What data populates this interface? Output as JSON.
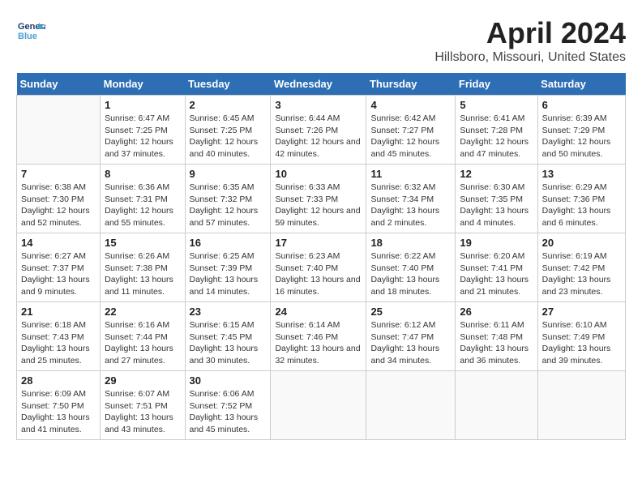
{
  "header": {
    "logo_line1": "General",
    "logo_line2": "Blue",
    "title": "April 2024",
    "subtitle": "Hillsboro, Missouri, United States"
  },
  "weekdays": [
    "Sunday",
    "Monday",
    "Tuesday",
    "Wednesday",
    "Thursday",
    "Friday",
    "Saturday"
  ],
  "weeks": [
    [
      {
        "day": "",
        "sunrise": "",
        "sunset": "",
        "daylight": ""
      },
      {
        "day": "1",
        "sunrise": "Sunrise: 6:47 AM",
        "sunset": "Sunset: 7:25 PM",
        "daylight": "Daylight: 12 hours and 37 minutes."
      },
      {
        "day": "2",
        "sunrise": "Sunrise: 6:45 AM",
        "sunset": "Sunset: 7:25 PM",
        "daylight": "Daylight: 12 hours and 40 minutes."
      },
      {
        "day": "3",
        "sunrise": "Sunrise: 6:44 AM",
        "sunset": "Sunset: 7:26 PM",
        "daylight": "Daylight: 12 hours and 42 minutes."
      },
      {
        "day": "4",
        "sunrise": "Sunrise: 6:42 AM",
        "sunset": "Sunset: 7:27 PM",
        "daylight": "Daylight: 12 hours and 45 minutes."
      },
      {
        "day": "5",
        "sunrise": "Sunrise: 6:41 AM",
        "sunset": "Sunset: 7:28 PM",
        "daylight": "Daylight: 12 hours and 47 minutes."
      },
      {
        "day": "6",
        "sunrise": "Sunrise: 6:39 AM",
        "sunset": "Sunset: 7:29 PM",
        "daylight": "Daylight: 12 hours and 50 minutes."
      }
    ],
    [
      {
        "day": "7",
        "sunrise": "Sunrise: 6:38 AM",
        "sunset": "Sunset: 7:30 PM",
        "daylight": "Daylight: 12 hours and 52 minutes."
      },
      {
        "day": "8",
        "sunrise": "Sunrise: 6:36 AM",
        "sunset": "Sunset: 7:31 PM",
        "daylight": "Daylight: 12 hours and 55 minutes."
      },
      {
        "day": "9",
        "sunrise": "Sunrise: 6:35 AM",
        "sunset": "Sunset: 7:32 PM",
        "daylight": "Daylight: 12 hours and 57 minutes."
      },
      {
        "day": "10",
        "sunrise": "Sunrise: 6:33 AM",
        "sunset": "Sunset: 7:33 PM",
        "daylight": "Daylight: 12 hours and 59 minutes."
      },
      {
        "day": "11",
        "sunrise": "Sunrise: 6:32 AM",
        "sunset": "Sunset: 7:34 PM",
        "daylight": "Daylight: 13 hours and 2 minutes."
      },
      {
        "day": "12",
        "sunrise": "Sunrise: 6:30 AM",
        "sunset": "Sunset: 7:35 PM",
        "daylight": "Daylight: 13 hours and 4 minutes."
      },
      {
        "day": "13",
        "sunrise": "Sunrise: 6:29 AM",
        "sunset": "Sunset: 7:36 PM",
        "daylight": "Daylight: 13 hours and 6 minutes."
      }
    ],
    [
      {
        "day": "14",
        "sunrise": "Sunrise: 6:27 AM",
        "sunset": "Sunset: 7:37 PM",
        "daylight": "Daylight: 13 hours and 9 minutes."
      },
      {
        "day": "15",
        "sunrise": "Sunrise: 6:26 AM",
        "sunset": "Sunset: 7:38 PM",
        "daylight": "Daylight: 13 hours and 11 minutes."
      },
      {
        "day": "16",
        "sunrise": "Sunrise: 6:25 AM",
        "sunset": "Sunset: 7:39 PM",
        "daylight": "Daylight: 13 hours and 14 minutes."
      },
      {
        "day": "17",
        "sunrise": "Sunrise: 6:23 AM",
        "sunset": "Sunset: 7:40 PM",
        "daylight": "Daylight: 13 hours and 16 minutes."
      },
      {
        "day": "18",
        "sunrise": "Sunrise: 6:22 AM",
        "sunset": "Sunset: 7:40 PM",
        "daylight": "Daylight: 13 hours and 18 minutes."
      },
      {
        "day": "19",
        "sunrise": "Sunrise: 6:20 AM",
        "sunset": "Sunset: 7:41 PM",
        "daylight": "Daylight: 13 hours and 21 minutes."
      },
      {
        "day": "20",
        "sunrise": "Sunrise: 6:19 AM",
        "sunset": "Sunset: 7:42 PM",
        "daylight": "Daylight: 13 hours and 23 minutes."
      }
    ],
    [
      {
        "day": "21",
        "sunrise": "Sunrise: 6:18 AM",
        "sunset": "Sunset: 7:43 PM",
        "daylight": "Daylight: 13 hours and 25 minutes."
      },
      {
        "day": "22",
        "sunrise": "Sunrise: 6:16 AM",
        "sunset": "Sunset: 7:44 PM",
        "daylight": "Daylight: 13 hours and 27 minutes."
      },
      {
        "day": "23",
        "sunrise": "Sunrise: 6:15 AM",
        "sunset": "Sunset: 7:45 PM",
        "daylight": "Daylight: 13 hours and 30 minutes."
      },
      {
        "day": "24",
        "sunrise": "Sunrise: 6:14 AM",
        "sunset": "Sunset: 7:46 PM",
        "daylight": "Daylight: 13 hours and 32 minutes."
      },
      {
        "day": "25",
        "sunrise": "Sunrise: 6:12 AM",
        "sunset": "Sunset: 7:47 PM",
        "daylight": "Daylight: 13 hours and 34 minutes."
      },
      {
        "day": "26",
        "sunrise": "Sunrise: 6:11 AM",
        "sunset": "Sunset: 7:48 PM",
        "daylight": "Daylight: 13 hours and 36 minutes."
      },
      {
        "day": "27",
        "sunrise": "Sunrise: 6:10 AM",
        "sunset": "Sunset: 7:49 PM",
        "daylight": "Daylight: 13 hours and 39 minutes."
      }
    ],
    [
      {
        "day": "28",
        "sunrise": "Sunrise: 6:09 AM",
        "sunset": "Sunset: 7:50 PM",
        "daylight": "Daylight: 13 hours and 41 minutes."
      },
      {
        "day": "29",
        "sunrise": "Sunrise: 6:07 AM",
        "sunset": "Sunset: 7:51 PM",
        "daylight": "Daylight: 13 hours and 43 minutes."
      },
      {
        "day": "30",
        "sunrise": "Sunrise: 6:06 AM",
        "sunset": "Sunset: 7:52 PM",
        "daylight": "Daylight: 13 hours and 45 minutes."
      },
      {
        "day": "",
        "sunrise": "",
        "sunset": "",
        "daylight": ""
      },
      {
        "day": "",
        "sunrise": "",
        "sunset": "",
        "daylight": ""
      },
      {
        "day": "",
        "sunrise": "",
        "sunset": "",
        "daylight": ""
      },
      {
        "day": "",
        "sunrise": "",
        "sunset": "",
        "daylight": ""
      }
    ]
  ]
}
